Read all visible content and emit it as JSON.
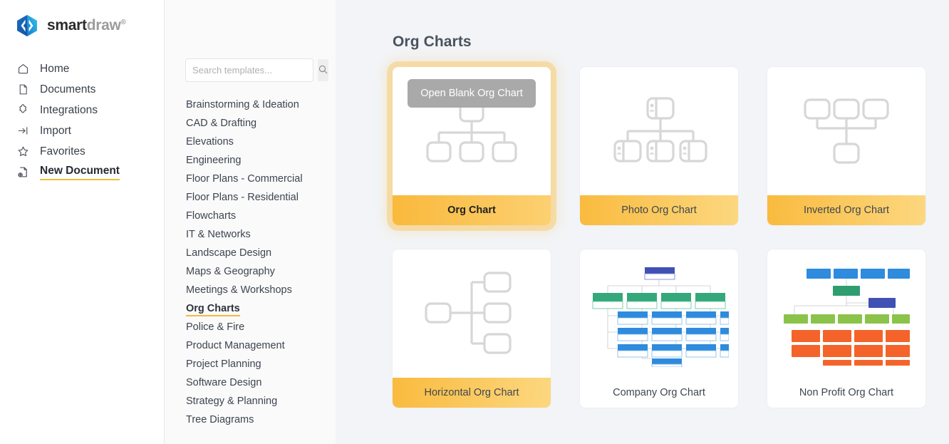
{
  "brand": {
    "name_bold": "smart",
    "name_light": "draw",
    "trademark": "®",
    "logo_icon": "smartdraw-diamond-logo",
    "colors": {
      "logo_dark": "#1a6fc4",
      "logo_light": "#29b6e8"
    }
  },
  "nav": {
    "items": [
      {
        "label": "Home",
        "icon": "home-icon",
        "active": false
      },
      {
        "label": "Documents",
        "icon": "document-icon",
        "active": false
      },
      {
        "label": "Integrations",
        "icon": "puzzle-piece-icon",
        "active": false
      },
      {
        "label": "Import",
        "icon": "import-arrow-icon",
        "active": false
      },
      {
        "label": "Favorites",
        "icon": "star-icon",
        "active": false
      },
      {
        "label": "New Document",
        "icon": "document-plus-icon",
        "active": true
      }
    ]
  },
  "search": {
    "placeholder": "Search templates...",
    "value": "",
    "button_icon": "search-icon"
  },
  "categories": {
    "items": [
      {
        "label": "Brainstorming & Ideation",
        "active": false
      },
      {
        "label": "CAD & Drafting",
        "active": false
      },
      {
        "label": "Elevations",
        "active": false
      },
      {
        "label": "Engineering",
        "active": false
      },
      {
        "label": "Floor Plans - Commercial",
        "active": false
      },
      {
        "label": "Floor Plans - Residential",
        "active": false
      },
      {
        "label": "Flowcharts",
        "active": false
      },
      {
        "label": "IT & Networks",
        "active": false
      },
      {
        "label": "Landscape Design",
        "active": false
      },
      {
        "label": "Maps & Geography",
        "active": false
      },
      {
        "label": "Meetings & Workshops",
        "active": false
      },
      {
        "label": "Org Charts",
        "active": true
      },
      {
        "label": "Police & Fire",
        "active": false
      },
      {
        "label": "Product Management",
        "active": false
      },
      {
        "label": "Project Planning",
        "active": false
      },
      {
        "label": "Software Design",
        "active": false
      },
      {
        "label": "Strategy & Planning",
        "active": false
      },
      {
        "label": "Tree Diagrams",
        "active": false
      }
    ]
  },
  "main": {
    "title": "Org Charts",
    "open_blank_button": "Open Blank Org Chart",
    "templates": [
      {
        "label": "Org Chart",
        "thumb": "org-chart-wireframe",
        "selected": true,
        "footer_highlight": true
      },
      {
        "label": "Photo Org Chart",
        "thumb": "photo-org-chart-wireframe",
        "selected": false,
        "footer_highlight": true
      },
      {
        "label": "Inverted Org Chart",
        "thumb": "inverted-org-chart-wireframe",
        "selected": false,
        "footer_highlight": true
      },
      {
        "label": "Horizontal Org Chart",
        "thumb": "horizontal-org-chart-wireframe",
        "selected": false,
        "footer_highlight": true
      },
      {
        "label": "Company Org Chart",
        "thumb": "company-org-chart-preview",
        "selected": false,
        "footer_highlight": false
      },
      {
        "label": "Non Profit Org Chart",
        "thumb": "non-profit-org-chart-preview",
        "selected": false,
        "footer_highlight": false
      }
    ]
  },
  "colors": {
    "accent": "#f6b93e",
    "footer_gradient_start": "#f9bb3f",
    "footer_gradient_end": "#fcd77f",
    "wireframe_stroke": "#d7d7d7",
    "blank_button_bg": "#a9a9a9",
    "main_bg": "#f2f4f7",
    "category_bg": "#fafafa",
    "preview_blue": "#2e8bdd",
    "preview_dark_blue": "#3f51b5",
    "preview_green": "#34a87a",
    "preview_light_green": "#8bc34a",
    "preview_orange": "#f4642a"
  }
}
